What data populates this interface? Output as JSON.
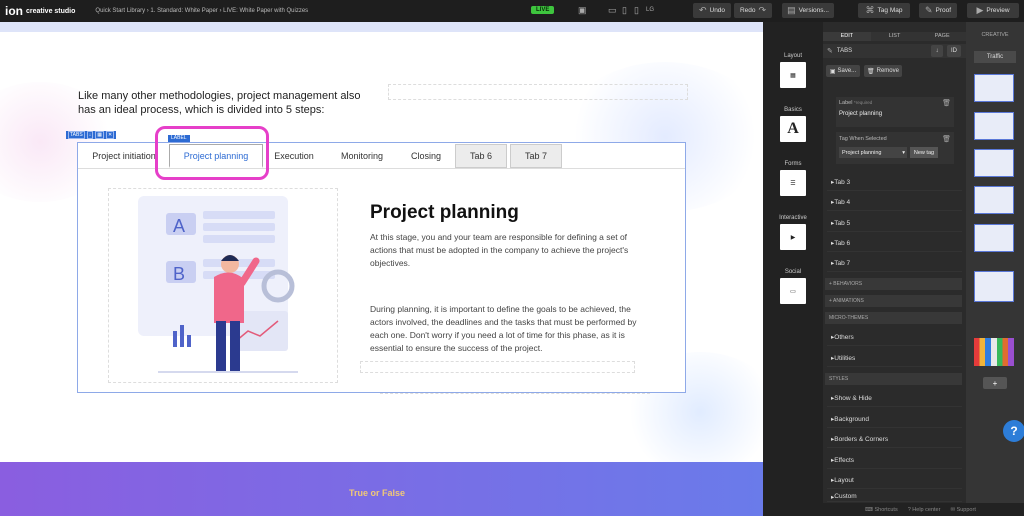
{
  "topbar": {
    "logo_ion": "ion",
    "logo_sub": "creative studio",
    "breadcrumb": "Quick Start Library  ›  1. Standard: White Paper  ›  LIVE: White Paper with Quizzes",
    "live": "LIVE",
    "breakpoint": "LG",
    "undo": "Undo",
    "redo": "Redo",
    "versions": "Versions...",
    "tagmap": "Tag Map",
    "proof": "Proof",
    "preview": "Preview"
  },
  "canvas": {
    "intro": "Like many other methodologies, project management also has an ideal process, which is divided into 5 steps:",
    "toolbar_label": "TABS",
    "label_tag": "LABEL",
    "tabs": [
      "Project initiation",
      "Project planning",
      "Execution",
      "Monitoring",
      "Closing",
      "Tab 6",
      "Tab 7"
    ],
    "content_title": "Project planning",
    "para1": "At this stage, you and your team are responsible for defining a set of actions that must be adopted in the company to achieve the project's objectives.",
    "para2": "During planning, it is important to define the goals to be achieved, the actors involved, the deadlines and the tasks that must be performed by each one. Don't worry if you need a lot of time for this phase, as it is essential to ensure the success of the project.",
    "footer_text": "True or False"
  },
  "sidenav": {
    "items": [
      "Layout",
      "Basics",
      "Forms",
      "Interactive",
      "Social"
    ]
  },
  "panel": {
    "tabs": [
      "EDIT",
      "LIST",
      "PAGE"
    ],
    "header": "TABS",
    "save": "Save...",
    "remove": "Remove",
    "label_field": "Label",
    "required": "*required",
    "label_value": "Project planning",
    "tag_field": "Tag When Selected",
    "tag_value": "Project planning",
    "new_tag": "New tag",
    "tab_items": [
      "Tab 3",
      "Tab 4",
      "Tab 5",
      "Tab 6",
      "Tab 7"
    ],
    "behaviors": "+ BEHAVIORS",
    "animations": "+ ANIMATIONS",
    "microthemes": "MICRO-THEMES",
    "micro_items": [
      "Others",
      "Utilities"
    ],
    "styles": "STYLES",
    "style_items": [
      "Show & Hide",
      "Background",
      "Borders & Corners",
      "Effects",
      "Layout",
      "Custom"
    ],
    "shortcuts": "Shortcuts",
    "helpcenter": "Help center",
    "support": "Support"
  },
  "creative": {
    "title": "CREATIVE",
    "traffic": "Traffic",
    "add": "+"
  },
  "colors": {
    "accent": "#2d6bd3",
    "highlight": "#e63fc9",
    "live": "#3ec53e"
  }
}
